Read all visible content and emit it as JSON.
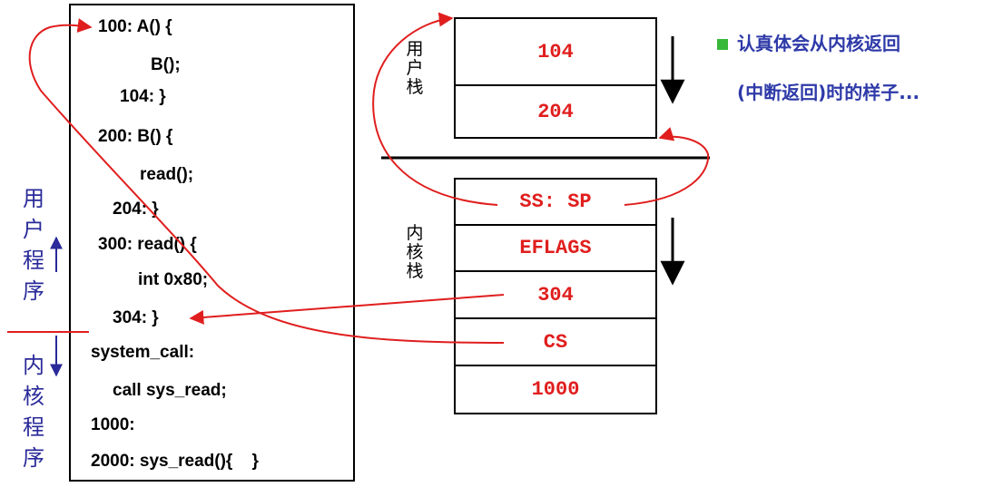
{
  "code_lines": [
    "100: A() {",
    "B();",
    "104: }",
    "200: B() {",
    "read();",
    "204: }",
    "300: read() {",
    "int 0x80;",
    "304: }",
    "system_call:",
    "call sys_read;",
    "1000:",
    "2000: sys_read(){    }"
  ],
  "labels": {
    "user_program": "用户程序",
    "kernel_program": "内核程序",
    "user_stack": "用户栈",
    "kernel_stack": "内核栈"
  },
  "user_stack": [
    "104",
    "204"
  ],
  "kernel_stack": [
    "SS: SP",
    "EFLAGS",
    "304",
    "CS",
    "1000"
  ],
  "note": {
    "line1": "认真体会从内核返回",
    "line2": "(中断返回)时的样子..."
  },
  "colors": {
    "arrow": "#e01e1e",
    "label": "#2a2a9a",
    "note": "#2e3aa8",
    "bullet": "#38b838"
  }
}
